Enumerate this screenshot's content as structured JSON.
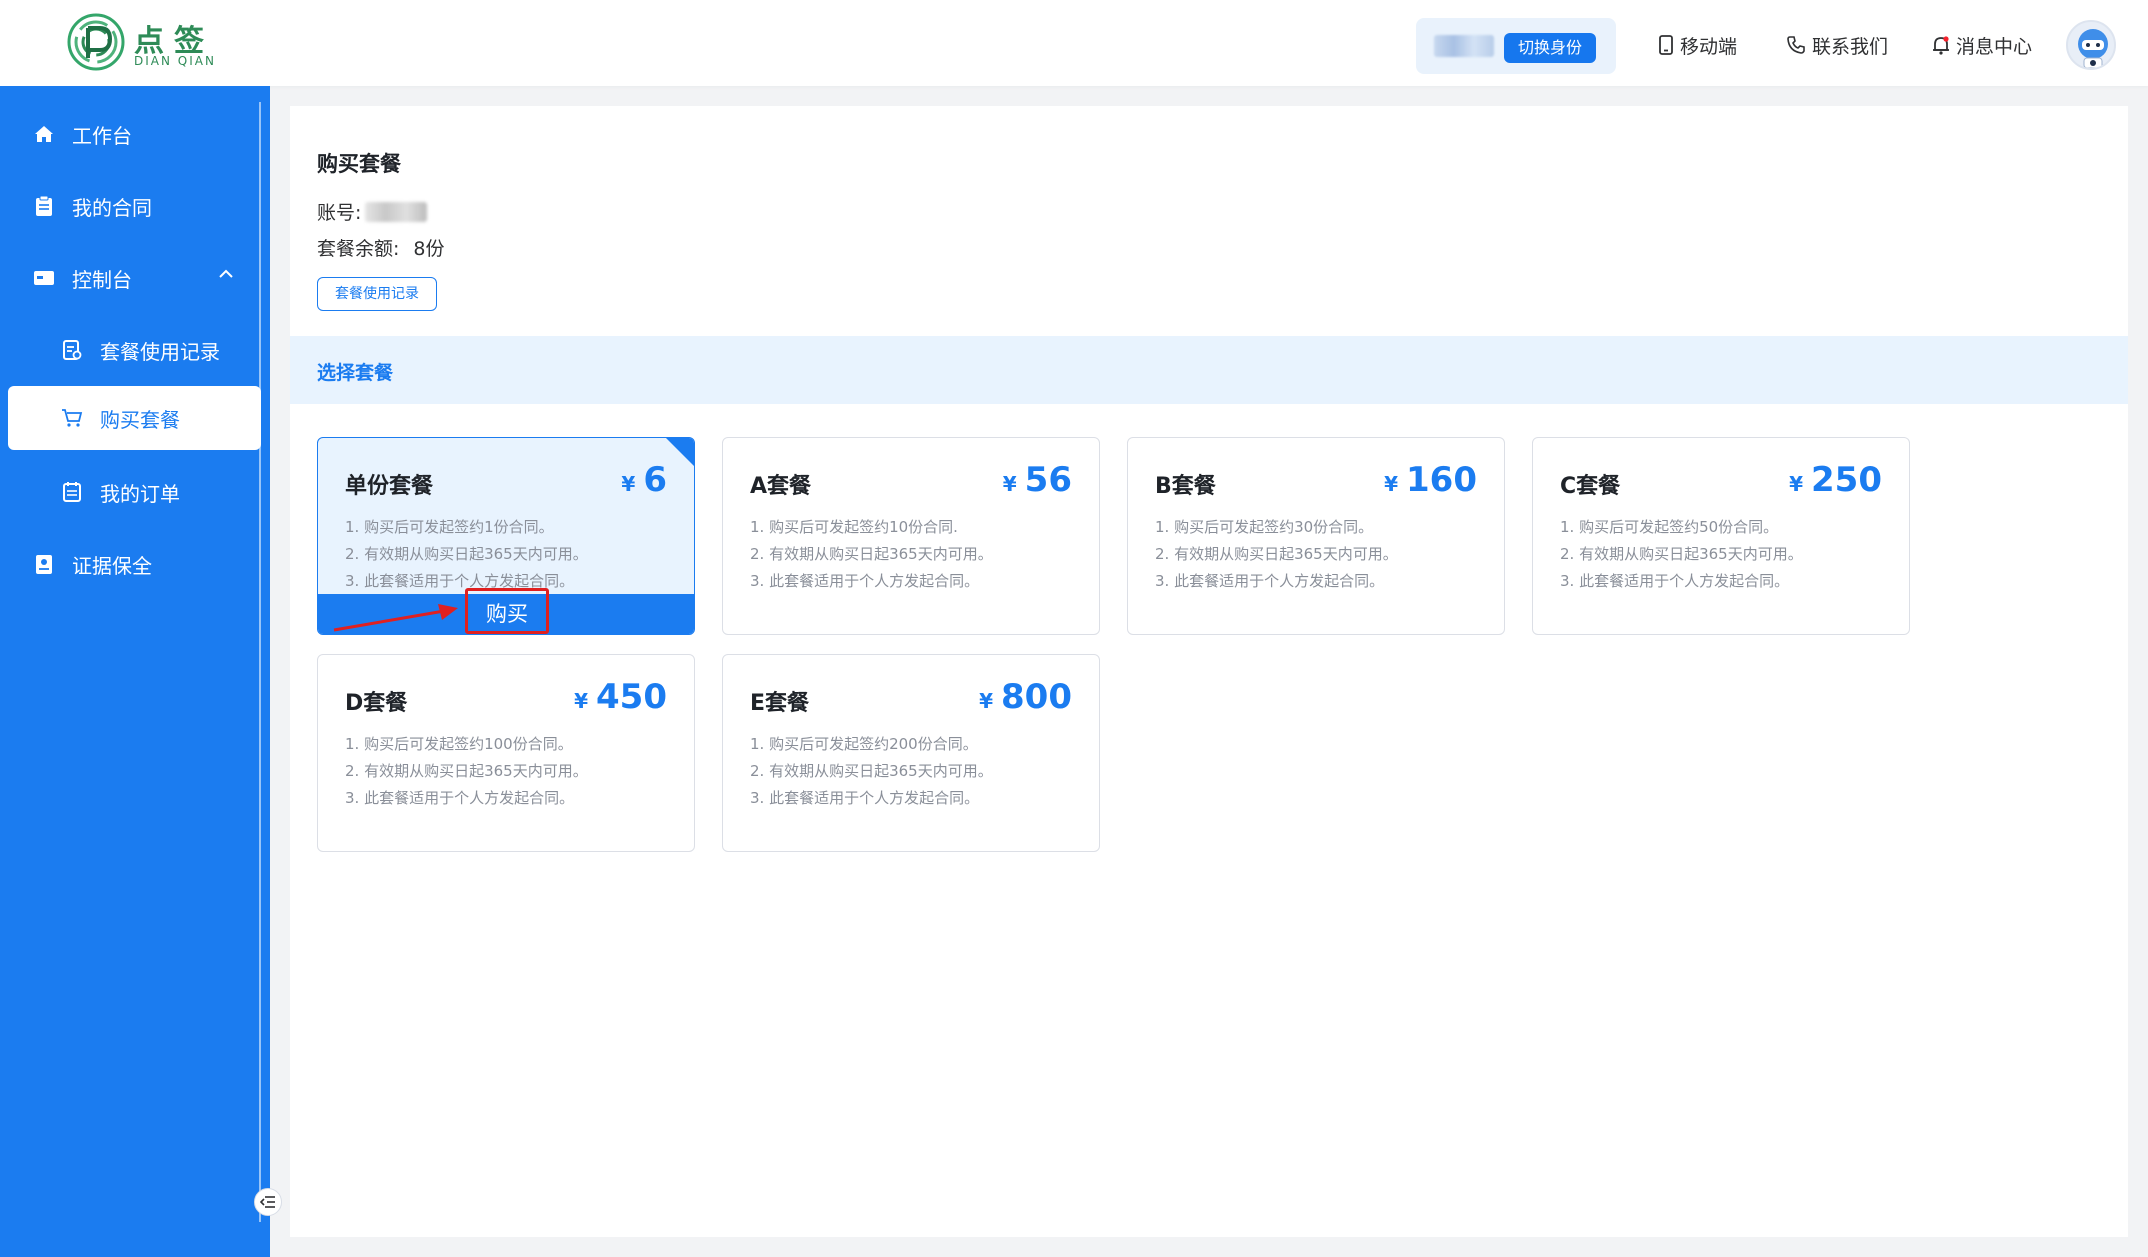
{
  "header": {
    "logo_cn": "点签",
    "logo_en": "DIAN QIAN",
    "switch_identity": "切换身份",
    "mobile": "移动端",
    "contact": "联系我们",
    "messages": "消息中心"
  },
  "sidebar": {
    "items": [
      {
        "label": "工作台",
        "icon": "home-icon"
      },
      {
        "label": "我的合同",
        "icon": "clipboard-icon"
      },
      {
        "label": "控制台",
        "icon": "console-icon"
      },
      {
        "label": "套餐使用记录",
        "icon": "record-icon"
      },
      {
        "label": "购买套餐",
        "icon": "cart-icon"
      },
      {
        "label": "我的订单",
        "icon": "order-icon"
      },
      {
        "label": "证据保全",
        "icon": "evidence-icon"
      }
    ],
    "active_index": 4
  },
  "main": {
    "title": "购买套餐",
    "account_label": "账号:",
    "balance_label": "套餐余额:",
    "balance_value": "8份",
    "usage_button": "套餐使用记录",
    "section_title": "选择套餐",
    "buy_label": "购买",
    "packages": [
      {
        "name": "单份套餐",
        "currency": "¥",
        "price": "6",
        "lines": [
          "1. 购买后可发起签约1份合同。",
          "2. 有效期从购买日起365天内可用。",
          "3. 此套餐适用于个人方发起合同。"
        ],
        "selected": true
      },
      {
        "name": "A套餐",
        "currency": "¥",
        "price": "56",
        "lines": [
          "1. 购买后可发起签约10份合同.",
          "2. 有效期从购买日起365天内可用。",
          "3. 此套餐适用于个人方发起合同。"
        ]
      },
      {
        "name": "B套餐",
        "currency": "¥",
        "price": "160",
        "lines": [
          "1. 购买后可发起签约30份合同。",
          "2. 有效期从购买日起365天内可用。",
          "3. 此套餐适用于个人方发起合同。"
        ]
      },
      {
        "name": "C套餐",
        "currency": "¥",
        "price": "250",
        "lines": [
          "1. 购买后可发起签约50份合同。",
          "2. 有效期从购买日起365天内可用。",
          "3. 此套餐适用于个人方发起合同。"
        ]
      },
      {
        "name": "D套餐",
        "currency": "¥",
        "price": "450",
        "lines": [
          "1. 购买后可发起签约100份合同。",
          "2. 有效期从购买日起365天内可用。",
          "3. 此套餐适用于个人方发起合同。"
        ]
      },
      {
        "name": "E套餐",
        "currency": "¥",
        "price": "800",
        "lines": [
          "1. 购买后可发起签约200份合同。",
          "2. 有效期从购买日起365天内可用。",
          "3. 此套餐适用于个人方发起合同。"
        ]
      }
    ]
  },
  "colors": {
    "primary": "#1b7cf0",
    "highlight": "#e02020",
    "brand_green": "#2e8b57"
  }
}
